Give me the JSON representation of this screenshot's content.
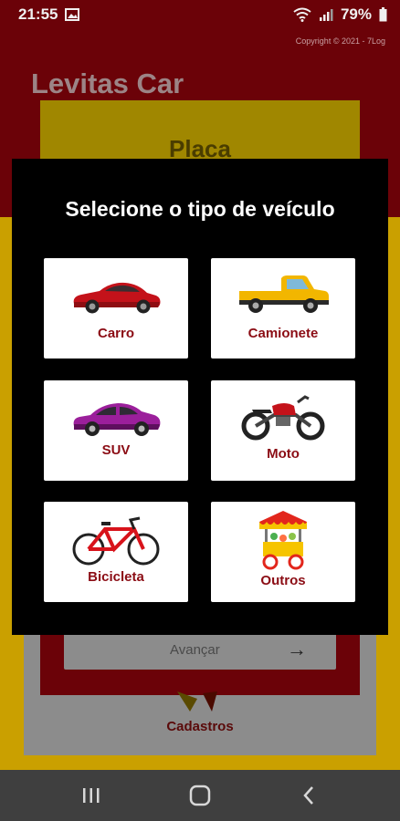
{
  "status_bar": {
    "time": "21:55",
    "battery": "79%"
  },
  "background": {
    "copyright": "Copyright © 2021 - 7Log",
    "app_title": "Levitas Car",
    "card_title": "Placa",
    "input_text": "Avançar",
    "arrow": "→",
    "cadastros_label": "Cadastros"
  },
  "modal": {
    "title": "Selecione o tipo de veículo",
    "options": [
      {
        "label": "Carro",
        "icon": "car-icon"
      },
      {
        "label": "Camionete",
        "icon": "pickup-truck-icon"
      },
      {
        "label": "SUV",
        "icon": "suv-icon"
      },
      {
        "label": "Moto",
        "icon": "motorcycle-icon"
      },
      {
        "label": "Bicicleta",
        "icon": "bicycle-icon"
      },
      {
        "label": "Outros",
        "icon": "food-cart-icon"
      }
    ]
  },
  "colors": {
    "accent_red": "#8b0c14",
    "modal_bg": "#000000",
    "tile_bg": "#ffffff"
  }
}
